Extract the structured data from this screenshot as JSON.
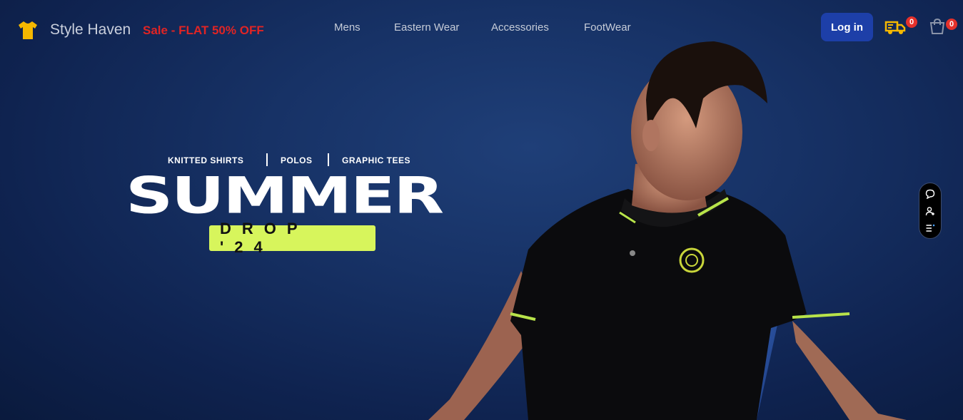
{
  "header": {
    "brand": "Style Haven",
    "sale": "Sale - FLAT 50% OFF",
    "nav": [
      "Mens",
      "Eastern Wear",
      "Accessories",
      "FootWear"
    ],
    "login_label": "Log in",
    "orders_count": "0",
    "cart_count": "0"
  },
  "hero": {
    "tags": [
      "KNITTED SHIRTS",
      "POLOS",
      "GRAPHIC TEES"
    ],
    "headline": "SUMMER",
    "subheadline": "DROP '24"
  },
  "icons": {
    "logo": "tshirt-icon",
    "orders": "delivery-truck-icon",
    "cart": "shopping-cart-icon",
    "sidebar": [
      "chat-icon",
      "user-add-icon",
      "list-icon"
    ]
  },
  "colors": {
    "background": "#173266",
    "sale": "#e02424",
    "login_button": "#1d3fa8",
    "accent_lime": "#d7f55c",
    "logo": "#f5b800",
    "badge": "#e5312b"
  }
}
